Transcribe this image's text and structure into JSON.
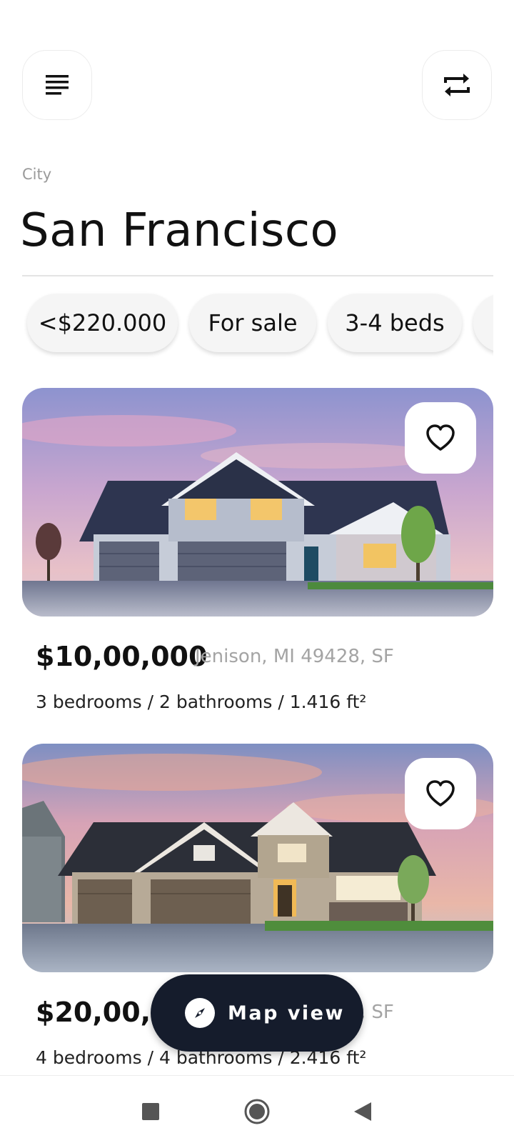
{
  "header": {
    "menu_icon": "menu-icon",
    "swap_icon": "repeat-icon"
  },
  "location": {
    "label": "City",
    "city": "San Francisco"
  },
  "filters": [
    {
      "label": "<$220.000"
    },
    {
      "label": "For sale"
    },
    {
      "label": "3-4 beds"
    },
    {
      "label": ""
    }
  ],
  "listings": [
    {
      "price": "$10,00,000",
      "address": "Jenison, MI 49428, SF",
      "specs": "3 bedrooms / 2 bathrooms / 1.416 ft²",
      "favorite_icon": "heart-outline-icon"
    },
    {
      "price": "$20,00,000",
      "address": "Jenison, MI 49428, SF",
      "specs": "4 bedrooms / 4 bathrooms / 2.416 ft²",
      "favorite_icon": "heart-outline-icon"
    }
  ],
  "map_button": {
    "label": "Map view",
    "icon": "compass-icon"
  },
  "nav_bar": {
    "recents_icon": "square-icon",
    "home_icon": "circle-icon",
    "back_icon": "triangle-back-icon"
  },
  "colors": {
    "background": "#ffffff",
    "map_button": "#151c2c",
    "chip": "#f5f5f5",
    "secondary_text": "#a4a4a4"
  }
}
